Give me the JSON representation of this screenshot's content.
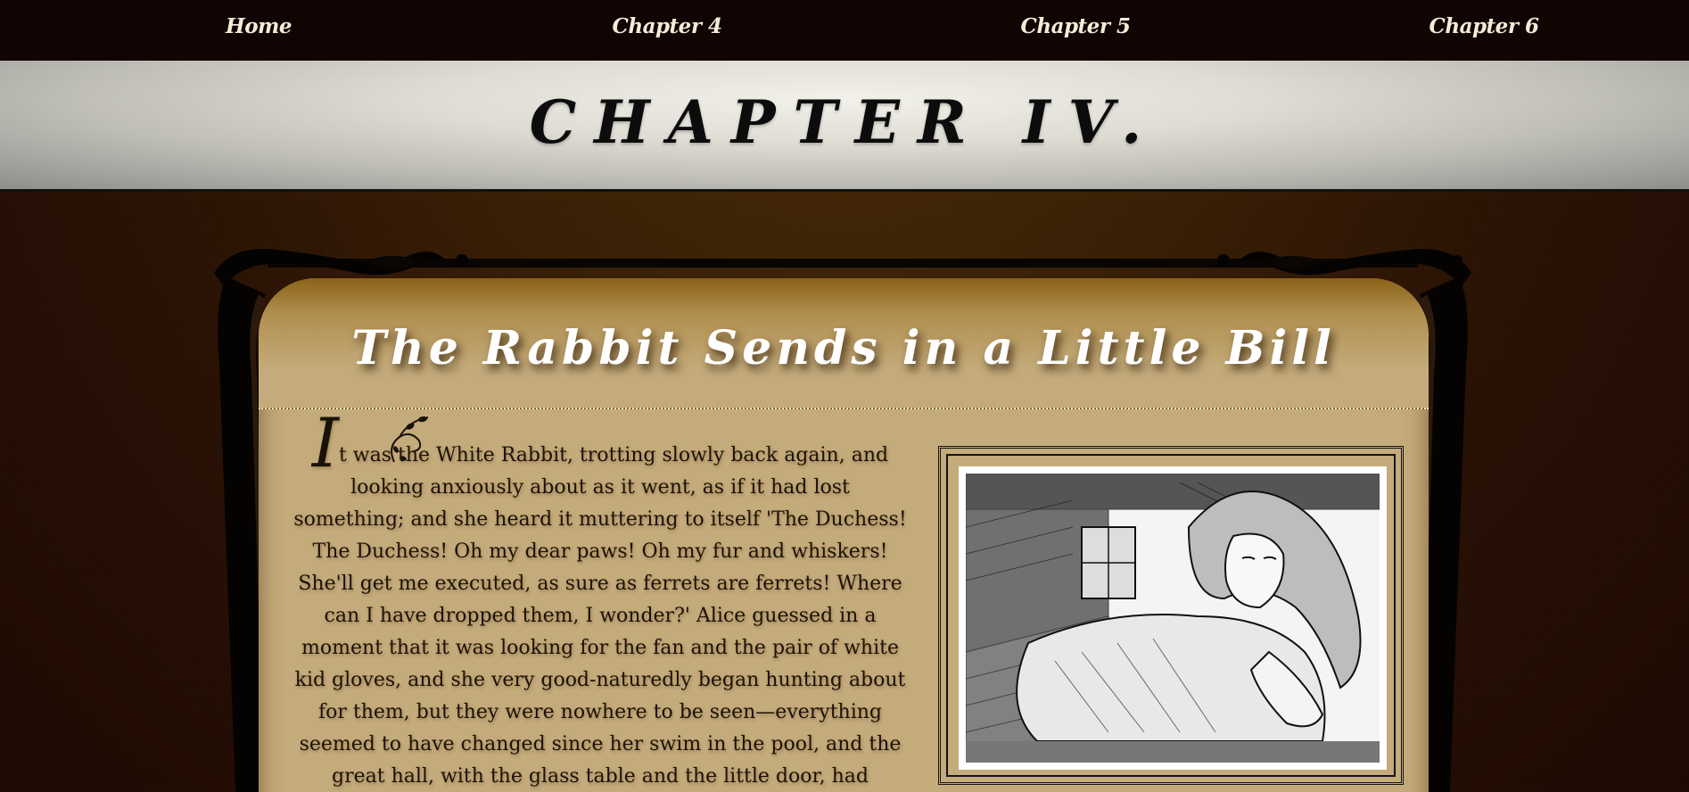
{
  "nav": {
    "items": [
      {
        "label": "Home"
      },
      {
        "label": "Chapter 4"
      },
      {
        "label": "Chapter 5"
      },
      {
        "label": "Chapter 6"
      }
    ]
  },
  "banner": {
    "title": "CHAPTER IV."
  },
  "section": {
    "title": "The Rabbit Sends in a Little Bill",
    "dropcap": "I",
    "paragraph": "t was the White Rabbit, trotting slowly back again, and looking anxiously about as it went, as if it had lost something; and she heard it muttering to itself 'The Duchess! The Duchess! Oh my dear paws! Oh my fur and whiskers! She'll get me executed, as sure as ferrets are ferrets! Where can I have dropped them, I wonder?' Alice guessed in a moment that it was looking for the fan and the pair of white kid gloves, and she very good-naturedly began hunting about for them, but they were nowhere to be seen—everything seemed to have changed since her swim in the pool, and the great hall, with the glass table and the little door, had"
  },
  "illustration": {
    "icon": "alice-in-small-room-illustration"
  },
  "colors": {
    "nav_bg": "#120403",
    "parchment": "#c4ab7b",
    "page_bg": "#2a1205",
    "nav_text": "#f5ecd6"
  }
}
